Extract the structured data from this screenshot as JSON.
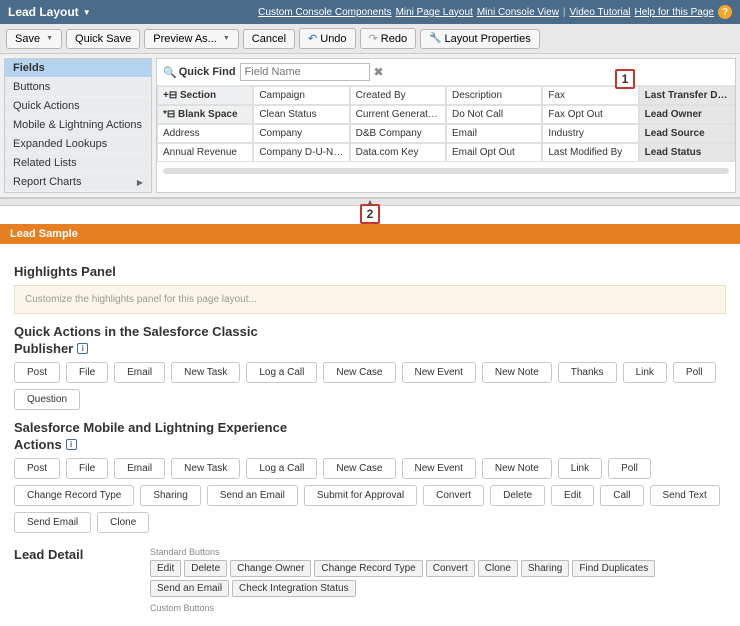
{
  "header": {
    "title": "Lead Layout",
    "links": {
      "custom_components": "Custom Console Components",
      "mini_layout": "Mini Page Layout",
      "mini_console": "Mini Console View",
      "video": "Video Tutorial",
      "help": "Help for this Page"
    }
  },
  "toolbar": {
    "save": "Save",
    "quick_save": "Quick Save",
    "preview_as": "Preview As...",
    "cancel": "Cancel",
    "undo": "Undo",
    "redo": "Redo",
    "layout_props": "Layout Properties"
  },
  "sidebar": {
    "items": [
      "Fields",
      "Buttons",
      "Quick Actions",
      "Mobile & Lightning Actions",
      "Expanded Lookups",
      "Related Lists",
      "Report Charts"
    ]
  },
  "quickfind": {
    "label": "Quick Find",
    "placeholder": "Field Name"
  },
  "palette": {
    "rows": [
      [
        "+⊟ Section",
        "Campaign",
        "Created By",
        "Description",
        "Fax",
        "Last Transfer Date"
      ],
      [
        "*⊟ Blank Space",
        "Clean Status",
        "Current Generator(s)",
        "Do Not Call",
        "Fax Opt Out",
        "Lead Owner"
      ],
      [
        "Address",
        "Company",
        "D&B Company",
        "Email",
        "Industry",
        "Lead Source"
      ],
      [
        "Annual Revenue",
        "Company D-U-N-S N...",
        "Data.com Key",
        "Email Opt Out",
        "Last Modified By",
        "Lead Status"
      ]
    ]
  },
  "markers": {
    "m1": "1",
    "m2": "2"
  },
  "orange_bar": "Lead Sample",
  "highlights": {
    "title": "Highlights Panel",
    "placeholder": "Customize the highlights panel for this page layout..."
  },
  "classic_actions": {
    "title_l1": "Quick Actions in the Salesforce Classic",
    "title_l2": "Publisher",
    "items": [
      "Post",
      "File",
      "Email",
      "New Task",
      "Log a Call",
      "New Case",
      "New Event",
      "New Note",
      "Thanks",
      "Link",
      "Poll",
      "Question"
    ]
  },
  "mobile_actions": {
    "title_l1": "Salesforce Mobile and Lightning Experience",
    "title_l2": "Actions",
    "items": [
      "Post",
      "File",
      "Email",
      "New Task",
      "Log a Call",
      "New Case",
      "New Event",
      "New Note",
      "Link",
      "Poll",
      "Change Record Type",
      "Sharing",
      "Send an Email",
      "Submit for Approval",
      "Convert",
      "Delete",
      "Edit",
      "Call",
      "Send Text",
      "Send Email",
      "Clone"
    ]
  },
  "detail": {
    "title": "Lead Detail",
    "std_label": "Standard Buttons",
    "custom_label": "Custom Buttons",
    "buttons": [
      "Edit",
      "Delete",
      "Change Owner",
      "Change Record Type",
      "Convert",
      "Clone",
      "Sharing",
      "Find Duplicates",
      "Send an Email",
      "Check Integration Status"
    ]
  }
}
